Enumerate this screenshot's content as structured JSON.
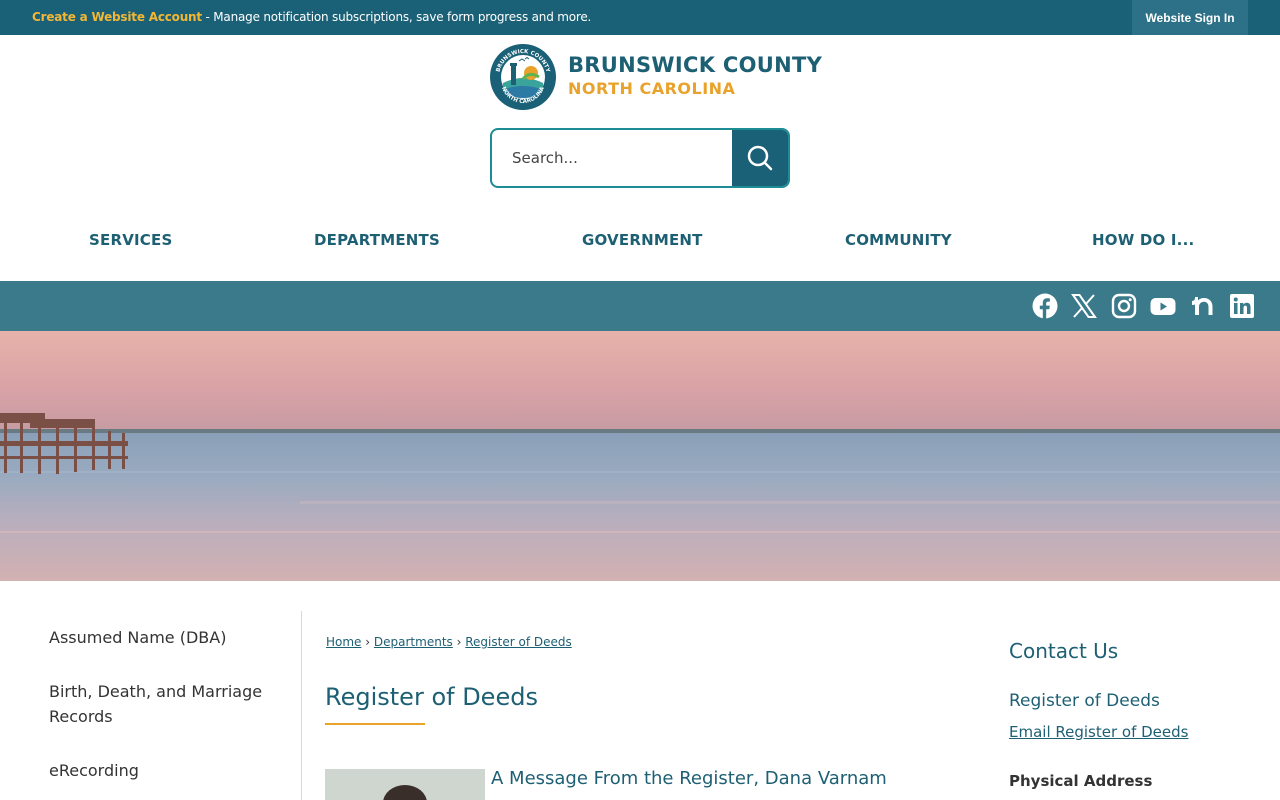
{
  "topbar": {
    "create_account_label": "Create a Website Account",
    "message": " - Manage notification subscriptions, save form progress and more.",
    "signin_label": "Website Sign In"
  },
  "logo": {
    "line1": "BRUNSWICK COUNTY",
    "line2": "NORTH CAROLINA",
    "seal_top_text": "BRUNSWICK COUNTY",
    "seal_bottom_text": "NORTH CAROLINA"
  },
  "search": {
    "placeholder": "Search..."
  },
  "nav": {
    "items": [
      {
        "label": "SERVICES"
      },
      {
        "label": "DEPARTMENTS"
      },
      {
        "label": "GOVERNMENT"
      },
      {
        "label": "COMMUNITY"
      },
      {
        "label": "HOW DO I..."
      }
    ]
  },
  "social": {
    "icons": [
      "facebook-icon",
      "x-icon",
      "instagram-icon",
      "youtube-icon",
      "nextdoor-icon",
      "linkedin-icon"
    ]
  },
  "sidebar": {
    "items": [
      {
        "label": "Assumed Name (DBA)"
      },
      {
        "label": "Birth, Death, and Marriage Records"
      },
      {
        "label": "eRecording"
      }
    ]
  },
  "breadcrumb": {
    "items": [
      {
        "label": "Home"
      },
      {
        "label": "Departments"
      },
      {
        "label": "Register of Deeds"
      }
    ],
    "separator": "›"
  },
  "main": {
    "title": "Register of Deeds",
    "article_title": "A Message From the Register, Dana Varnam"
  },
  "contact": {
    "heading": "Contact Us",
    "department": "Register of Deeds",
    "email_link": "Email Register of Deeds",
    "address_label": "Physical Address"
  },
  "colors": {
    "brand_teal": "#1a6076",
    "accent_gold": "#e9a22b",
    "social_bar": "#3a7a8a"
  }
}
